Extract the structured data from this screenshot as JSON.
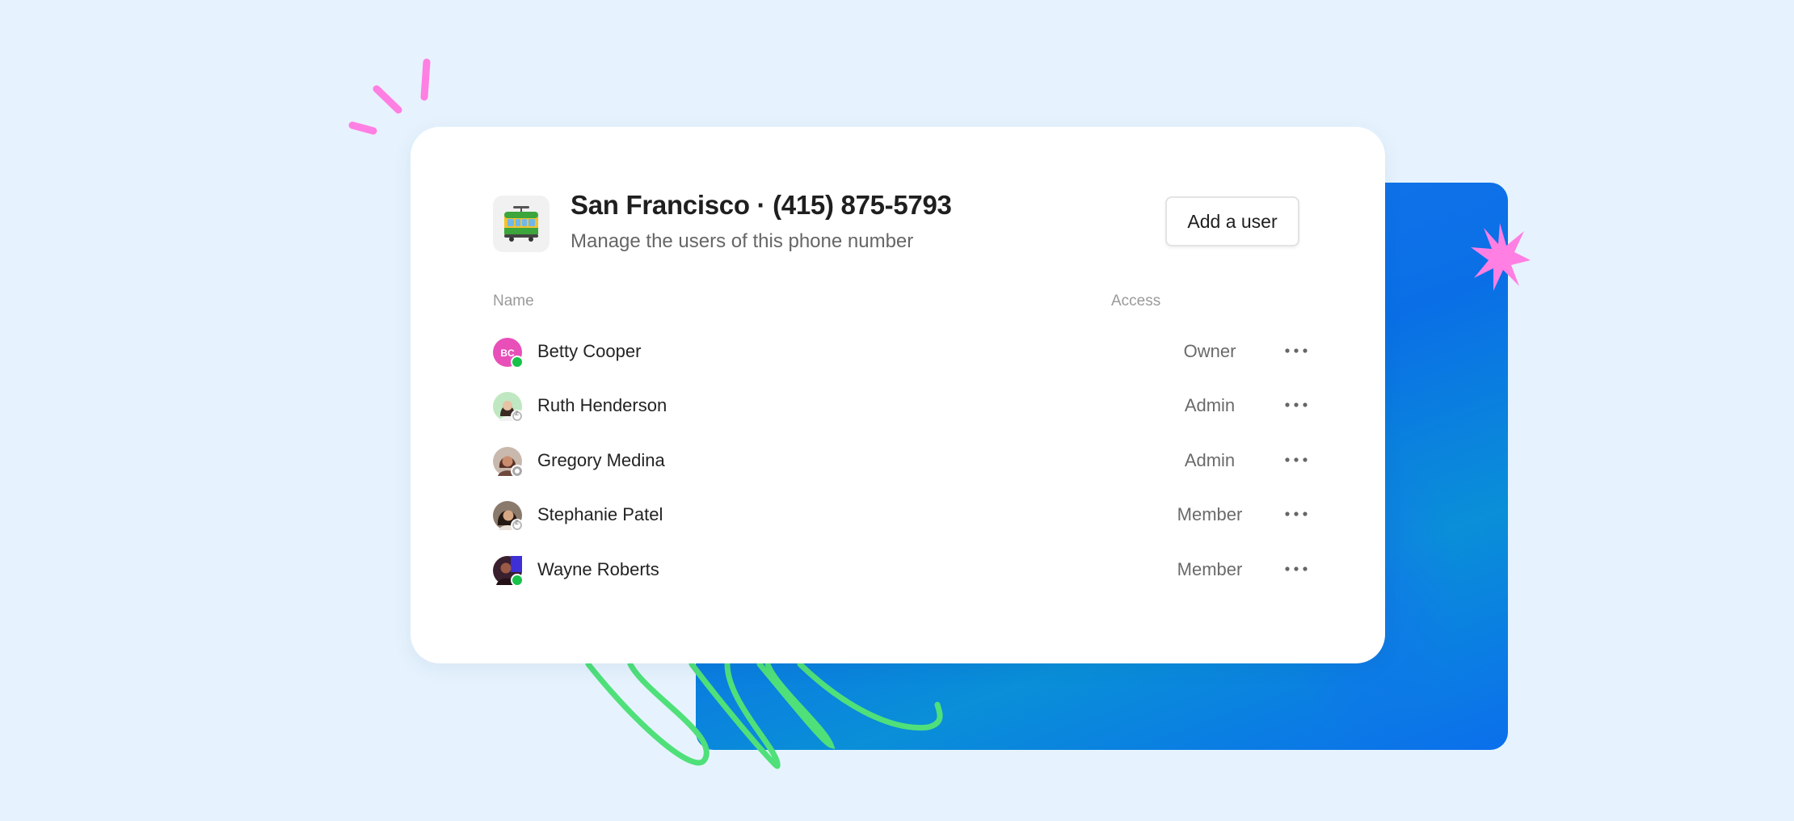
{
  "header": {
    "title": "San Francisco · (415) 875-5793",
    "subtitle": "Manage the users of this phone number",
    "add_user_label": "Add a user",
    "logo_icon": "tram-icon"
  },
  "table": {
    "col_name": "Name",
    "col_access": "Access"
  },
  "users": [
    {
      "name": "Betty Cooper",
      "initials": "BC",
      "access": "Owner",
      "status": "online",
      "avatar_color": "#e84fb8"
    },
    {
      "name": "Ruth Henderson",
      "initials": "",
      "access": "Admin",
      "status": "away",
      "avatar_color": "#bfe8c2"
    },
    {
      "name": "Gregory Medina",
      "initials": "",
      "access": "Admin",
      "status": "offline",
      "avatar_color": "#7a4a3a"
    },
    {
      "name": "Stephanie Patel",
      "initials": "",
      "access": "Member",
      "status": "away",
      "avatar_color": "#5a3b2e"
    },
    {
      "name": "Wayne Roberts",
      "initials": "",
      "access": "Member",
      "status": "online",
      "avatar_color": "#3a1f2e"
    }
  ],
  "colors": {
    "background": "#e6f3fe",
    "accent_blue": "#0a6fe6",
    "deco_pink": "#ff7fe3",
    "deco_green": "#4fe07a",
    "online": "#17c24a"
  }
}
